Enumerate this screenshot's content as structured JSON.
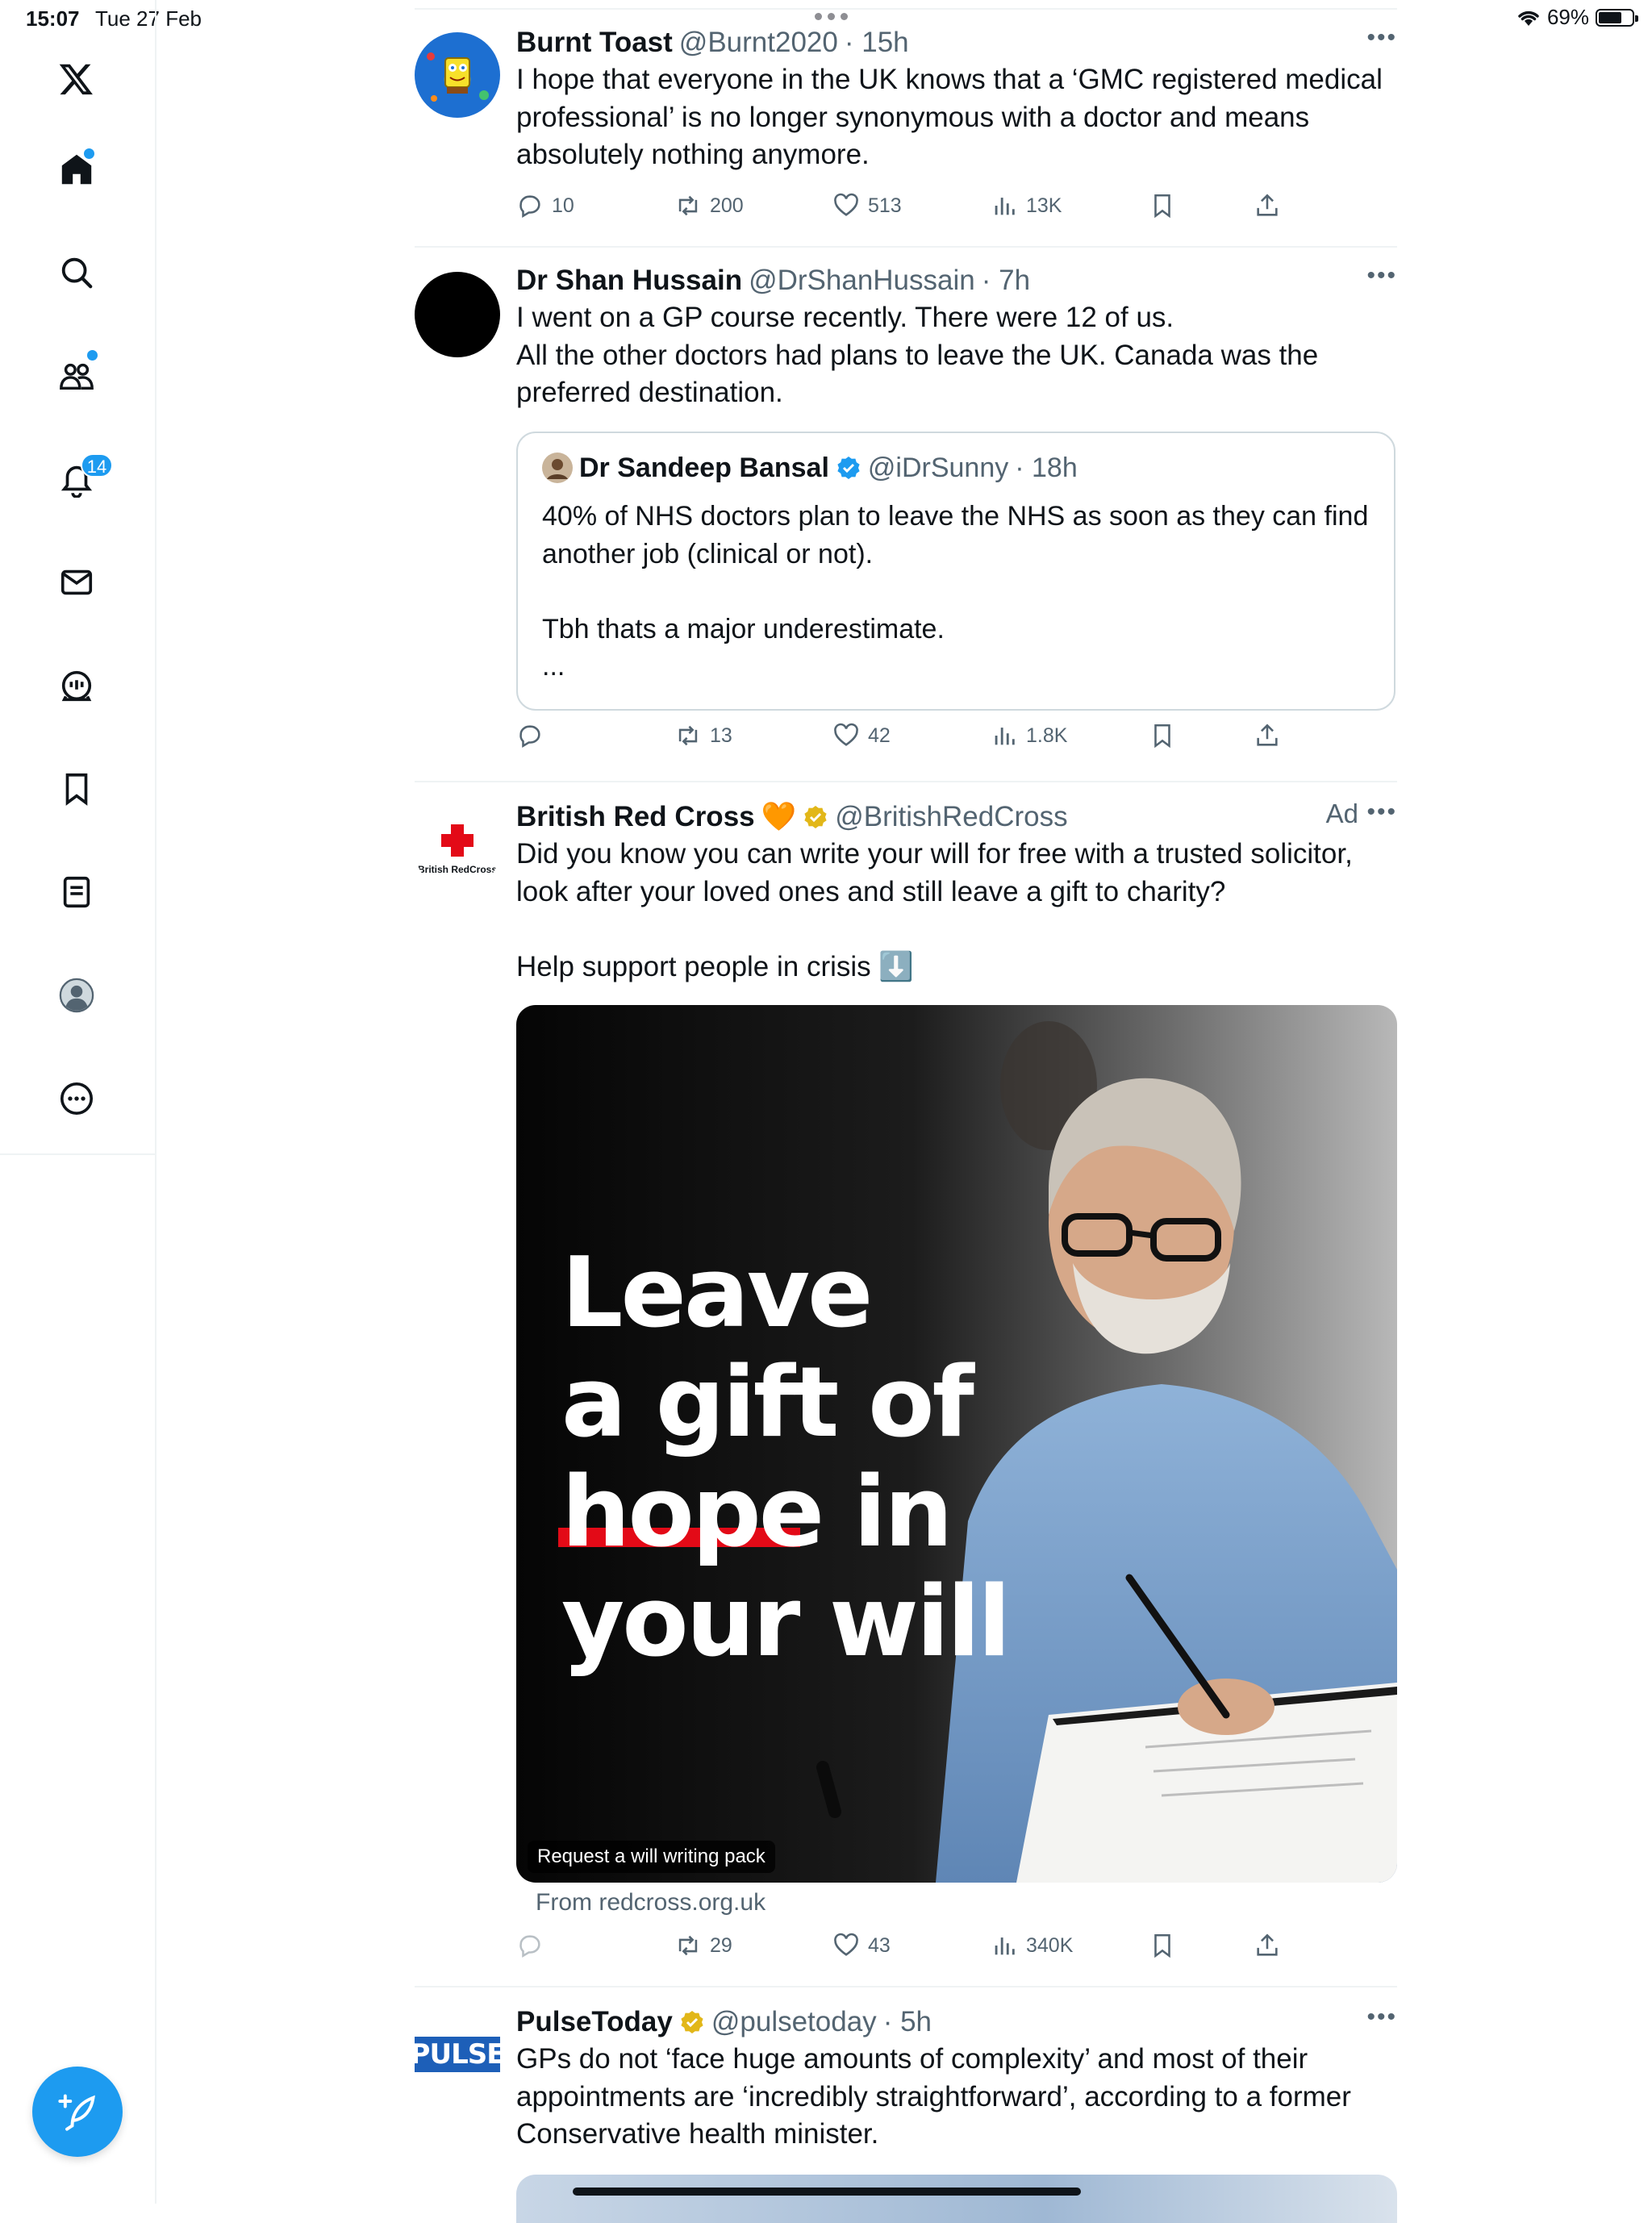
{
  "status_bar": {
    "time": "15:07",
    "date": "Tue 27 Feb",
    "battery": "69%",
    "battery_level": 0.69
  },
  "sidebar": {
    "notifications_badge": "14"
  },
  "tweets": [
    {
      "name": "Burnt Toast",
      "handle": "@Burnt2020",
      "time": "· 15h",
      "text": "I hope that everyone in the UK knows that a ‘GMC registered medical professional’ is no longer synonymous with a doctor and means absolutely nothing anymore.",
      "stats": {
        "replies": "10",
        "retweets": "200",
        "likes": "513",
        "views": "13K"
      }
    },
    {
      "name": "Dr Shan Hussain",
      "handle": "@DrShanHussain",
      "time": "· 7h",
      "text": "I went on a GP course recently. There were 12 of us.\nAll the other doctors had plans to leave the UK. Canada was the preferred destination.",
      "quote": {
        "name": "Dr Sandeep Bansal",
        "handle": "@iDrSunny",
        "time": "· 18h",
        "text": "40% of NHS doctors plan to leave the NHS as soon as they can find another job (clinical or not).\n\nTbh thats a major underestimate.\n..."
      },
      "stats": {
        "replies": "",
        "retweets": "13",
        "likes": "42",
        "views": "1.8K"
      }
    },
    {
      "name": "British Red Cross",
      "emoji": "🧡",
      "handle": "@BritishRedCross",
      "ad_label": "Ad",
      "avatar_text": "British RedCross",
      "text": "Did you know you can write your will for free with a trusted solicitor, look after your loved ones and still leave a gift to charity?\n\nHelp support people in crisis ⬇️",
      "media": {
        "line1": "Leave",
        "line2": "a gift of",
        "line3": "hope in",
        "line4": "your will",
        "caption": "Request a will writing pack"
      },
      "source": "From redcross.org.uk",
      "stats": {
        "replies": "",
        "retweets": "29",
        "likes": "43",
        "views": "340K"
      }
    },
    {
      "name": "PulseToday",
      "handle": "@pulsetoday",
      "time": "· 5h",
      "avatar_text": "PULSE",
      "text": "GPs do not ‘face huge amounts of complexity’ and most of their appointments are ‘incredibly straightforward’, according to a former Conservative health minister."
    }
  ]
}
